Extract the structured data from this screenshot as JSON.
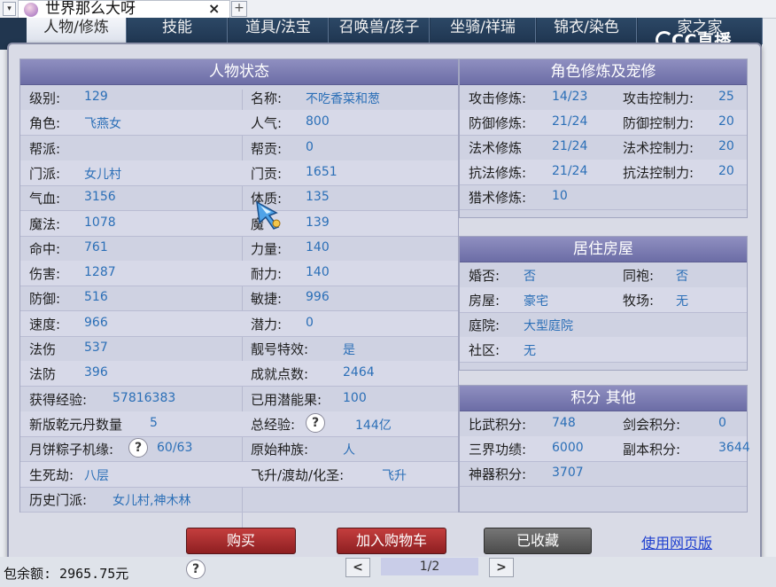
{
  "browser": {
    "tab_title": "世界那么大呀",
    "close_glyph": "×",
    "new_tab_glyph": "+",
    "menu_glyph": "▾"
  },
  "game_tabs": [
    "人物/修炼",
    "技能",
    "道具/法宝",
    "召唤兽/孩子",
    "坐骑/祥瑞",
    "锦衣/染色",
    "家之家"
  ],
  "cc_logo": "CC直播",
  "status": {
    "title": "人物状态",
    "left_rows": [
      {
        "label": "级别:",
        "value": "129"
      },
      {
        "label": "角色:",
        "value": "飞燕女"
      },
      {
        "label": "帮派:",
        "value": ""
      },
      {
        "label": "门派:",
        "value": "女儿村"
      },
      {
        "label": "气血:",
        "value": "3156"
      },
      {
        "label": "魔法:",
        "value": "1078"
      },
      {
        "label": "命中:",
        "value": "761"
      },
      {
        "label": "伤害:",
        "value": "1287"
      },
      {
        "label": "防御:",
        "value": "516"
      },
      {
        "label": "速度:",
        "value": "966"
      },
      {
        "label": "法伤",
        "value": "537"
      },
      {
        "label": "法防",
        "value": "396"
      },
      {
        "label": "获得经验:",
        "value": "57816383"
      },
      {
        "label": "新版乾元丹数量",
        "value": "5"
      },
      {
        "label": "月饼粽子机缘:",
        "value": "60/63"
      },
      {
        "label": "生死劫:",
        "value": "八层"
      },
      {
        "label": "历史门派:",
        "value": "女儿村,神木林"
      }
    ],
    "right_rows": [
      {
        "label": "名称:",
        "value": "不吃香菜和葱"
      },
      {
        "label": "人气:",
        "value": "800"
      },
      {
        "label": "帮贡:",
        "value": "0"
      },
      {
        "label": "门贡:",
        "value": "1651"
      },
      {
        "label": "体质:",
        "value": "135"
      },
      {
        "label": "魔",
        "value": "139"
      },
      {
        "label": "力量:",
        "value": "140"
      },
      {
        "label": "耐力:",
        "value": "140"
      },
      {
        "label": "敏捷:",
        "value": "996"
      },
      {
        "label": "潜力:",
        "value": "0"
      },
      {
        "label": "靓号特效:",
        "value": "是"
      },
      {
        "label": "成就点数:",
        "value": "2464"
      },
      {
        "label": "已用潜能果:",
        "value": "100"
      },
      {
        "label": "总经验:",
        "value": "144亿"
      },
      {
        "label": "原始种族:",
        "value": "人"
      },
      {
        "label": "飞升/渡劫/化圣:",
        "value": "飞升"
      }
    ]
  },
  "cultivation": {
    "title": "角色修炼及宠修",
    "rows": [
      {
        "label": "攻击修炼:",
        "value": "14/23",
        "label2": "攻击控制力:",
        "value2": "25"
      },
      {
        "label": "防御修炼:",
        "value": "21/24",
        "label2": "防御控制力:",
        "value2": "20"
      },
      {
        "label": "法术修炼",
        "value": "21/24",
        "label2": "法术控制力:",
        "value2": "20"
      },
      {
        "label": "抗法修炼:",
        "value": "21/24",
        "label2": "抗法控制力:",
        "value2": "20"
      },
      {
        "label": "猎术修炼:",
        "value": "10",
        "label2": "",
        "value2": ""
      }
    ]
  },
  "housing": {
    "title": "居住房屋",
    "rows": [
      {
        "label": "婚否:",
        "value": "否",
        "label2": "同袍:",
        "value2": "否"
      },
      {
        "label": "房屋:",
        "value": "豪宅",
        "label2": "牧场:",
        "value2": "无"
      },
      {
        "label": "庭院:",
        "value": "大型庭院",
        "label2": "",
        "value2": ""
      },
      {
        "label": "社区:",
        "value": "无",
        "label2": "",
        "value2": ""
      }
    ]
  },
  "points": {
    "title": "积分 其他",
    "rows": [
      {
        "label": "比武积分:",
        "value": "748",
        "label2": "剑会积分:",
        "value2": "0"
      },
      {
        "label": "三界功绩:",
        "value": "6000",
        "label2": "副本积分:",
        "value2": "3644"
      },
      {
        "label": "神器积分:",
        "value": "3707",
        "label2": "",
        "value2": ""
      }
    ]
  },
  "actions": {
    "buy": "购买",
    "add_cart": "加入购物车",
    "favorited": "已收藏",
    "web_version": "使用网页版"
  },
  "footer": {
    "balance": "包余额: 2965.75元",
    "page": "1/2",
    "prev": "<",
    "next": ">",
    "help": "?"
  },
  "colors": {
    "value_text": "#2b6fb7",
    "header_purple": "#7b7cb3",
    "buy_red": "#a92e30",
    "link_blue": "#1e3fcf"
  }
}
